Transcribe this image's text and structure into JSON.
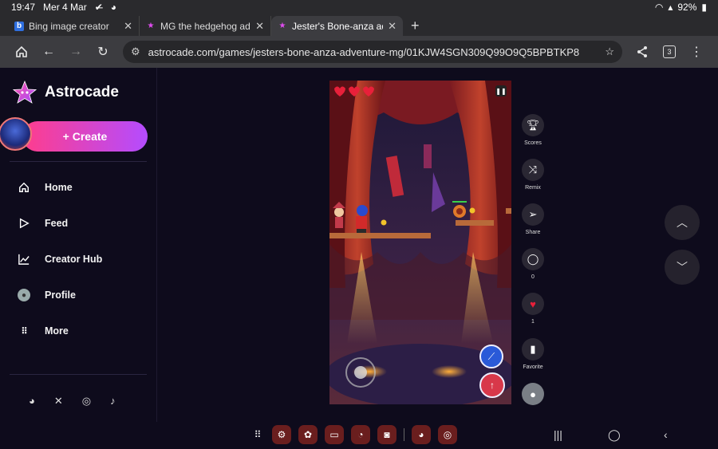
{
  "status": {
    "time": "19:47",
    "date": "Mer 4 Mar",
    "battery": "92%"
  },
  "tabs": [
    {
      "title": "Bing image creator"
    },
    {
      "title": "MG the hedgehog adven"
    },
    {
      "title": "Jester's Bone-anza adve"
    }
  ],
  "url": "astrocade.com/games/jesters-bone-anza-adventure-mg/01KJW4SGN309Q99O9Q5BPBTKP8",
  "tab_count": "3",
  "brand": {
    "name": "Astrocade"
  },
  "create_label": "+ Create",
  "menu": [
    {
      "label": "Home"
    },
    {
      "label": "Feed"
    },
    {
      "label": "Creator Hub"
    },
    {
      "label": "Profile"
    },
    {
      "label": "More"
    }
  ],
  "actions": {
    "scores": "Scores",
    "remix": "Remix",
    "share": "Share",
    "comments_count": "0",
    "likes_count": "1",
    "favorite": "Favorite"
  },
  "colors": {
    "accent_start": "#ff3d8c",
    "accent_end": "#b44cff",
    "background": "#0e0b1c"
  }
}
